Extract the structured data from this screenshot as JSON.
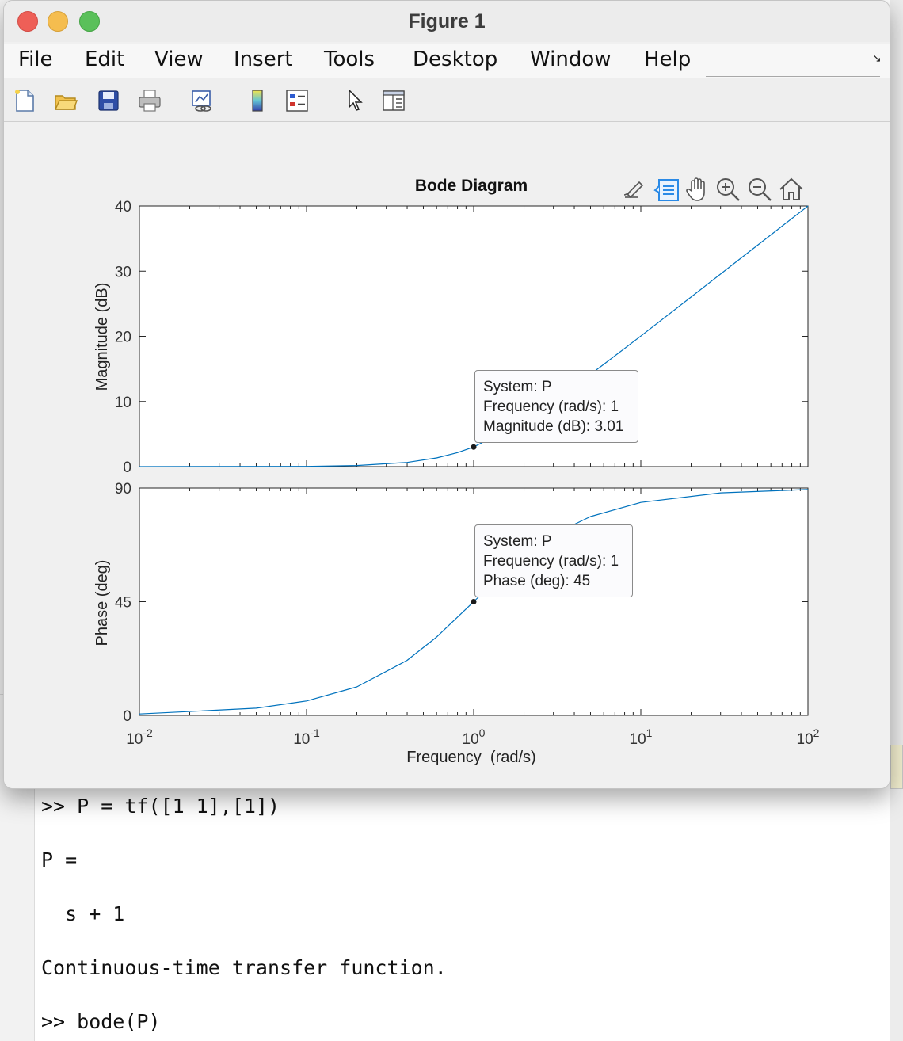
{
  "window": {
    "title": "Figure 1",
    "menu": [
      "File",
      "Edit",
      "View",
      "Insert",
      "Tools",
      "Desktop",
      "Window",
      "Help"
    ]
  },
  "toolbar": {
    "icons": [
      "new-figure-icon",
      "open-file-icon",
      "save-icon",
      "print-icon",
      "link-plot-icon",
      "colorbar-icon",
      "legend-icon",
      "edit-plot-pointer-icon",
      "property-inspector-icon"
    ]
  },
  "axes_toolbar": {
    "icons": [
      "brush-icon",
      "data-tips-icon",
      "pan-hand-icon",
      "zoom-in-icon",
      "zoom-out-icon",
      "restore-view-home-icon"
    ],
    "active_color": "#2a8ae6"
  },
  "chart_data": {
    "type": "line",
    "title": "Bode Diagram",
    "xlabel": "Frequency  (rad/s)",
    "x_scale": "log",
    "xlim": [
      0.01,
      100
    ],
    "x_ticks": [
      {
        "base": "10",
        "exp": "-2"
      },
      {
        "base": "10",
        "exp": "-1"
      },
      {
        "base": "10",
        "exp": "0"
      },
      {
        "base": "10",
        "exp": "1"
      },
      {
        "base": "10",
        "exp": "2"
      }
    ],
    "line_color": "#0072bd",
    "magnitude": {
      "ylabel": "Magnitude (dB)",
      "ylim": [
        0,
        40
      ],
      "y_ticks": [
        "0",
        "10",
        "20",
        "30",
        "40"
      ],
      "x": [
        0.01,
        0.1,
        0.2,
        0.4,
        0.6,
        0.8,
        1,
        2,
        4,
        6,
        10,
        20,
        40,
        100
      ],
      "y": [
        0.0,
        0.04,
        0.17,
        0.64,
        1.34,
        2.15,
        3.01,
        6.99,
        12.3,
        15.7,
        20.04,
        26.03,
        32.05,
        40.0
      ]
    },
    "phase": {
      "ylabel": "Phase (deg)",
      "ylim": [
        0,
        90
      ],
      "y_ticks": [
        "0",
        "45",
        "90"
      ],
      "x": [
        0.01,
        0.05,
        0.1,
        0.2,
        0.4,
        0.6,
        1,
        1.5,
        2,
        3,
        5,
        10,
        30,
        100
      ],
      "y": [
        0.57,
        2.86,
        5.71,
        11.3,
        21.8,
        31.0,
        45.0,
        56.3,
        63.4,
        71.6,
        78.7,
        84.3,
        88.1,
        89.4
      ]
    },
    "datatips": [
      {
        "panel": "magnitude",
        "x": 1,
        "y": 3.01,
        "lines": [
          "System: P",
          "Frequency (rad/s): 1",
          "Magnitude (dB): 3.01"
        ]
      },
      {
        "panel": "phase",
        "x": 1,
        "y": 45,
        "lines": [
          "System: P",
          "Frequency (rad/s): 1",
          "Phase (deg): 45"
        ]
      }
    ]
  },
  "command_window": {
    "lines": [
      ">> P = tf([1 1],[1])",
      "P =",
      "  s + 1",
      "Continuous-time transfer function.",
      ">> bode(P)"
    ]
  }
}
